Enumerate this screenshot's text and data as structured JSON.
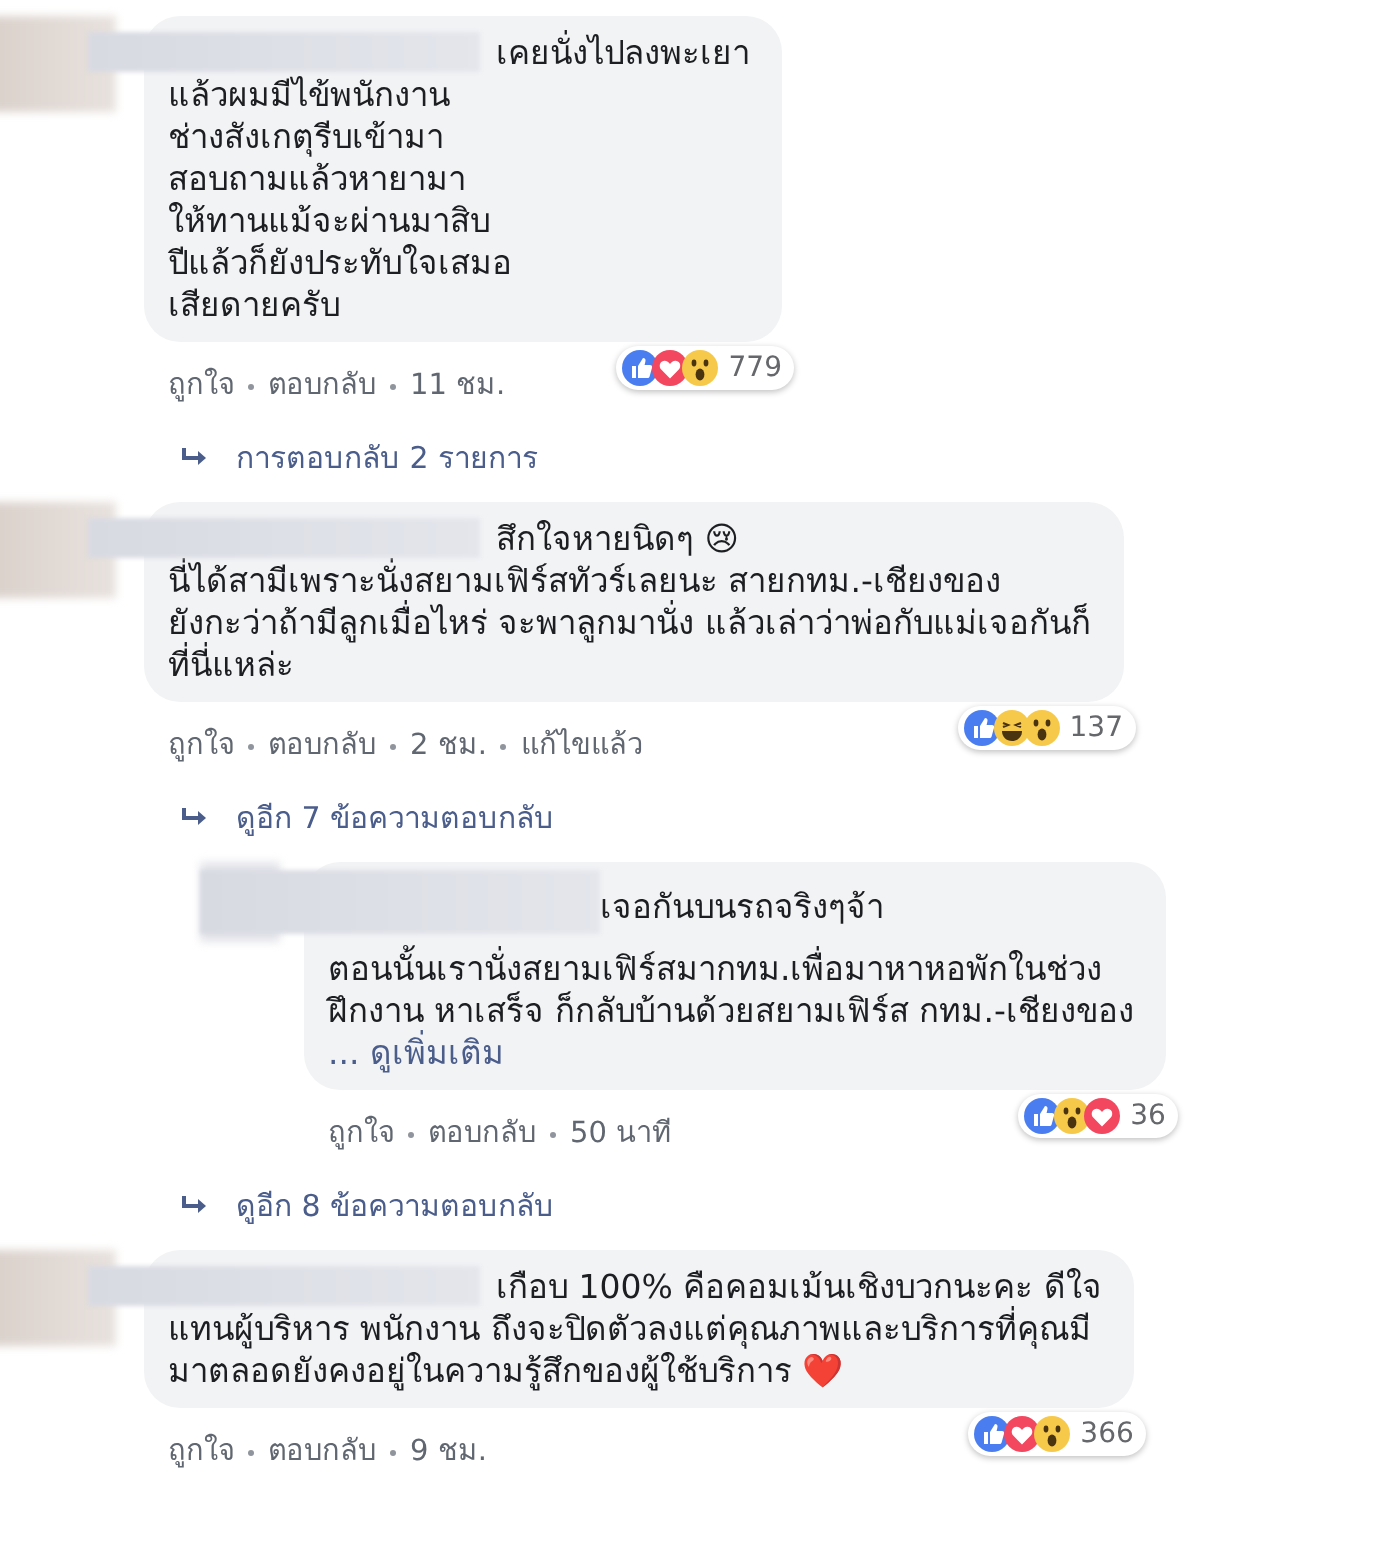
{
  "comments": [
    {
      "nested": false,
      "first_line": "เคยนั่งไปลงพะเยา",
      "text": "แล้วผมมีไข้พนักงาน\nช่างสังเกตุรีบเข้ามา\nสอบถามแล้วหายามา\nให้ทานแม้จะผ่านมาสิบ\nปีแล้วก็ยังประทับใจเสมอ\nเสียดายครับ",
      "reactions": [
        {
          "kind": "like"
        },
        {
          "kind": "love"
        },
        {
          "kind": "wow"
        }
      ],
      "count": "779",
      "meta": [
        "ถูกใจ",
        "ตอบกลับ",
        "11 ชม."
      ],
      "replies_link": "การตอบกลับ 2 รายการ"
    },
    {
      "nested": false,
      "first_line": "สึกใจหายนิดๆ 😢",
      "text": "นี่ได้สามีเพราะนั่งสยามเฟิร์สทัวร์เลยนะ สายกทม.-เชียงของ\nยังกะว่าถ้ามีลูกเมื่อไหร่ จะพาลูกมานั่ง แล้วเล่าว่าพ่อกับแม่เจอกันก็\nที่นี่แหล่ะ",
      "reactions": [
        {
          "kind": "like"
        },
        {
          "kind": "haha"
        },
        {
          "kind": "wow"
        }
      ],
      "count": "137",
      "meta": [
        "ถูกใจ",
        "ตอบกลับ",
        "2 ชม.",
        "แก้ไขแล้ว"
      ],
      "replies_link": "ดูอีก 7 ข้อความตอบกลับ"
    },
    {
      "nested": true,
      "first_line": "เจอกันบนรถจริงๆจ้า",
      "text": "ตอนนั้นเรานั่งสยามเฟิร์สมากทม.เพื่อมาหาหอพักในช่วง\nฝึกงาน หาเสร็จ ก็กลับบ้านด้วยสยามเฟิร์ส กทม.-เชียงของ",
      "see_more": "... ดูเพิ่มเติม",
      "reactions": [
        {
          "kind": "like"
        },
        {
          "kind": "wow"
        },
        {
          "kind": "love"
        }
      ],
      "count": "36",
      "meta": [
        "ถูกใจ",
        "ตอบกลับ",
        "50 นาที"
      ],
      "replies_link": "ดูอีก 8 ข้อความตอบกลับ"
    },
    {
      "nested": false,
      "first_line": "เกือบ 100% คือคอมเม้นเชิงบวกนะคะ ดีใจ",
      "text": "แทนผู้บริหาร พนักงาน ถึงจะปิดตัวลงแต่คุณภาพและบริการที่คุณมี\nมาตลอดยังคงอยู่ในความรู้สึกของผู้ใช้บริการ ❤️",
      "reactions": [
        {
          "kind": "like"
        },
        {
          "kind": "love"
        },
        {
          "kind": "wow"
        }
      ],
      "count": "366",
      "meta": [
        "ถูกใจ",
        "ตอบกลับ",
        "9 ชม."
      ]
    }
  ]
}
